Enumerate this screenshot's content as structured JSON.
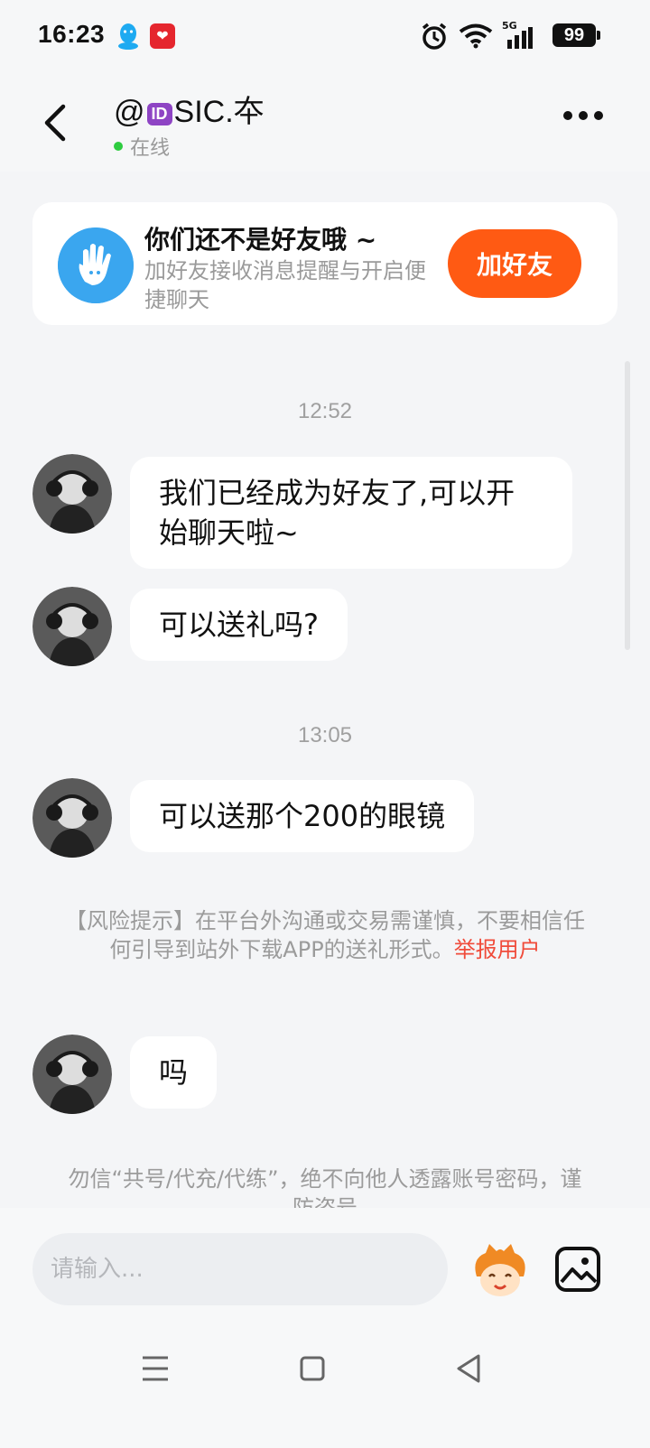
{
  "status_bar": {
    "time": "16:23",
    "battery": "99",
    "network": "5G",
    "icons": [
      "qq-icon",
      "app-icon",
      "alarm-icon",
      "wifi-icon",
      "signal-icon",
      "battery-icon"
    ]
  },
  "header": {
    "title_prefix": "@",
    "id_badge": "ID",
    "title_suffix": "SIC.夲",
    "status": "在线"
  },
  "friend_card": {
    "title": "你们还不是好友哦 ~",
    "subtitle": "加好友接收消息提醒与开启便捷聊天",
    "button": "加好友"
  },
  "messages": [
    {
      "type": "timestamp",
      "text": "12:52"
    },
    {
      "type": "incoming",
      "text": "我们已经成为好友了,可以开始聊天啦~"
    },
    {
      "type": "incoming",
      "text": "可以送礼吗?"
    },
    {
      "type": "timestamp",
      "text": "13:05"
    },
    {
      "type": "incoming",
      "text": "可以送那个200的眼镜"
    },
    {
      "type": "notice",
      "text": "【风险提示】在平台外沟通或交易需谨慎，不要相信任何引导到站外下载APP的送礼形式。",
      "link": "举报用户"
    },
    {
      "type": "incoming",
      "text": "吗"
    },
    {
      "type": "notice",
      "text": "勿信“共号/代充/代练”，绝不向他人透露账号密码，谨防盗号"
    }
  ],
  "input": {
    "placeholder": "请输入..."
  },
  "colors": {
    "accent": "#ff5a13",
    "online": "#2ecc40",
    "report_link": "#f04b3a",
    "background": "#f4f5f7"
  }
}
